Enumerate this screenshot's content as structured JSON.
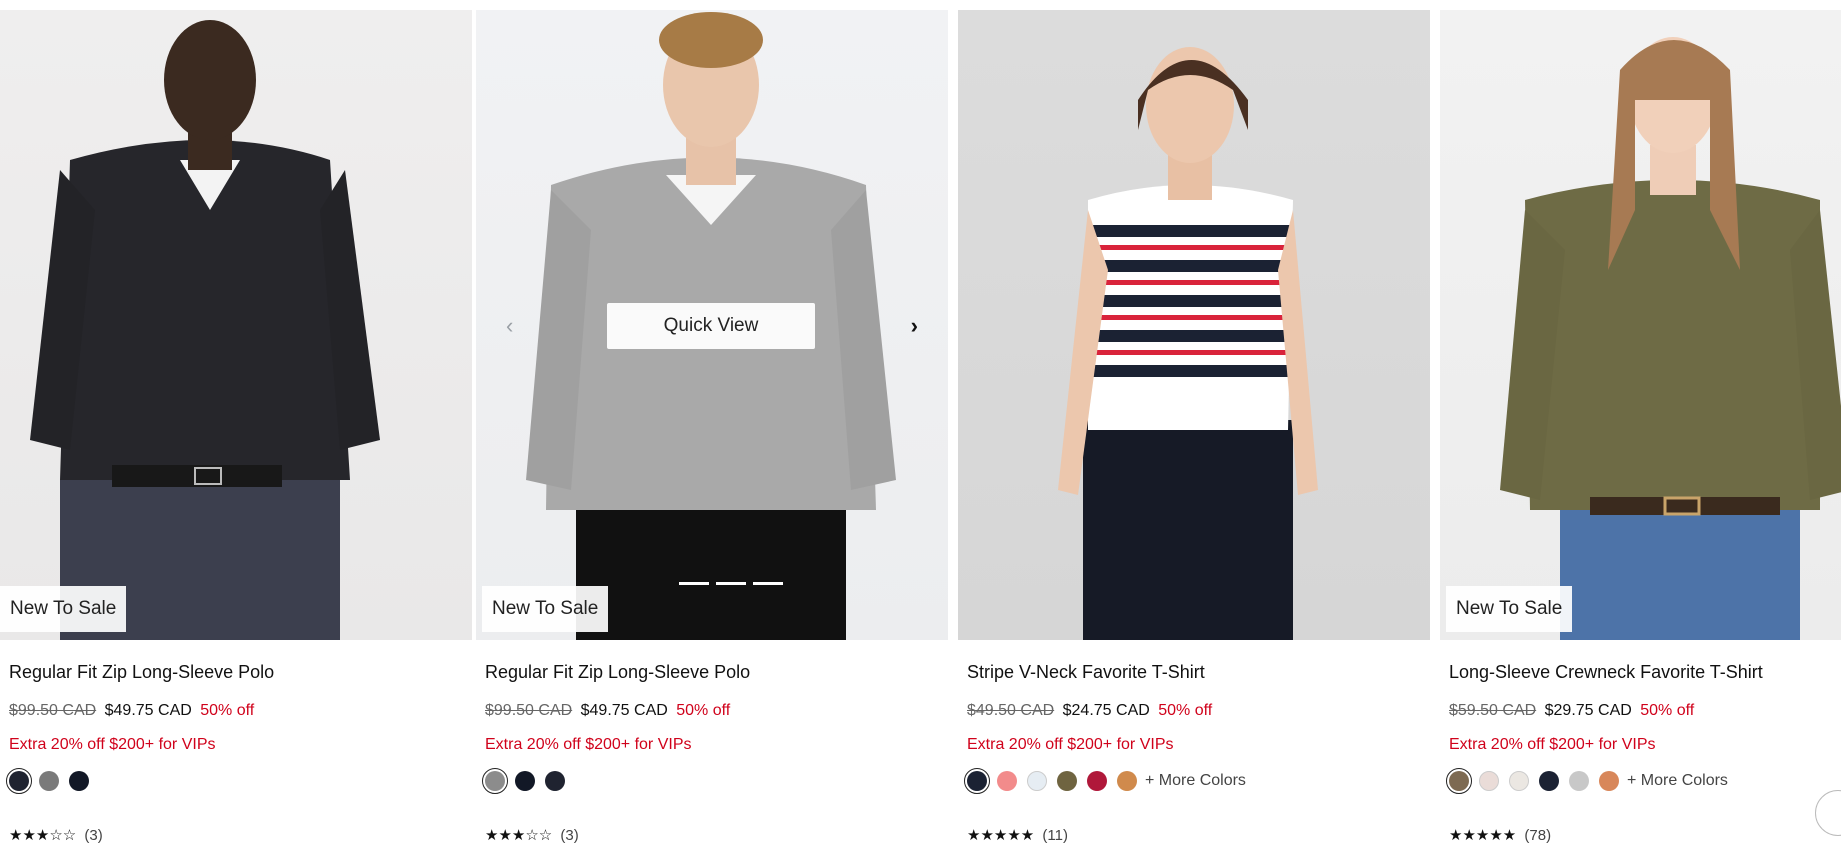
{
  "products": [
    {
      "badge": "New To Sale",
      "title": "Regular Fit Zip Long-Sleeve Polo",
      "price_original": "$99.50 CAD",
      "price_sale": "$49.75 CAD",
      "discount": "50% off",
      "promo": "Extra 20% off $200+ for VIPs",
      "swatches": [
        "#1f2330",
        "#7a7a7a",
        "#121826"
      ],
      "selected_swatch": 0,
      "more_colors": "",
      "stars": "★★★☆☆",
      "rating_count": "(3)"
    },
    {
      "badge": "New To Sale",
      "title": "Regular Fit Zip Long-Sleeve Polo",
      "price_original": "$99.50 CAD",
      "price_sale": "$49.75 CAD",
      "discount": "50% off",
      "promo": "Extra 20% off $200+ for VIPs",
      "swatches": [
        "#8c8c8c",
        "#121826",
        "#1f2330"
      ],
      "selected_swatch": 0,
      "more_colors": "",
      "stars": "★★★☆☆",
      "rating_count": "(3)",
      "quick_view": "Quick View",
      "carousel_prev": "‹",
      "carousel_next": "›"
    },
    {
      "badge": "",
      "title": "Stripe V-Neck Favorite T-Shirt",
      "price_original": "$49.50 CAD",
      "price_sale": "$24.75 CAD",
      "discount": "50% off",
      "promo": "Extra 20% off $200+ for VIPs",
      "swatches": [
        "#1b2233",
        "#f28b8b",
        "#e6edf3",
        "#6f6440",
        "#b0183a",
        "#d08a4c"
      ],
      "selected_swatch": 0,
      "more_colors": "+ More Colors",
      "stars": "★★★★★",
      "rating_count": "(11)"
    },
    {
      "badge": "New To Sale",
      "title": "Long-Sleeve Crewneck Favorite T-Shirt",
      "price_original": "$59.50 CAD",
      "price_sale": "$29.75 CAD",
      "discount": "50% off",
      "promo": "Extra 20% off $200+ for VIPs",
      "swatches": [
        "#7d6a52",
        "#eadcd8",
        "#ebe7e2",
        "#1b2233",
        "#c8c8c8",
        "#d8875a"
      ],
      "selected_swatch": 0,
      "more_colors": "+ More Colors",
      "stars": "★★★★★",
      "rating_count": "(78)"
    }
  ],
  "colors": {
    "sale_red": "#d0021b",
    "text": "#111111",
    "muted": "#666666"
  }
}
